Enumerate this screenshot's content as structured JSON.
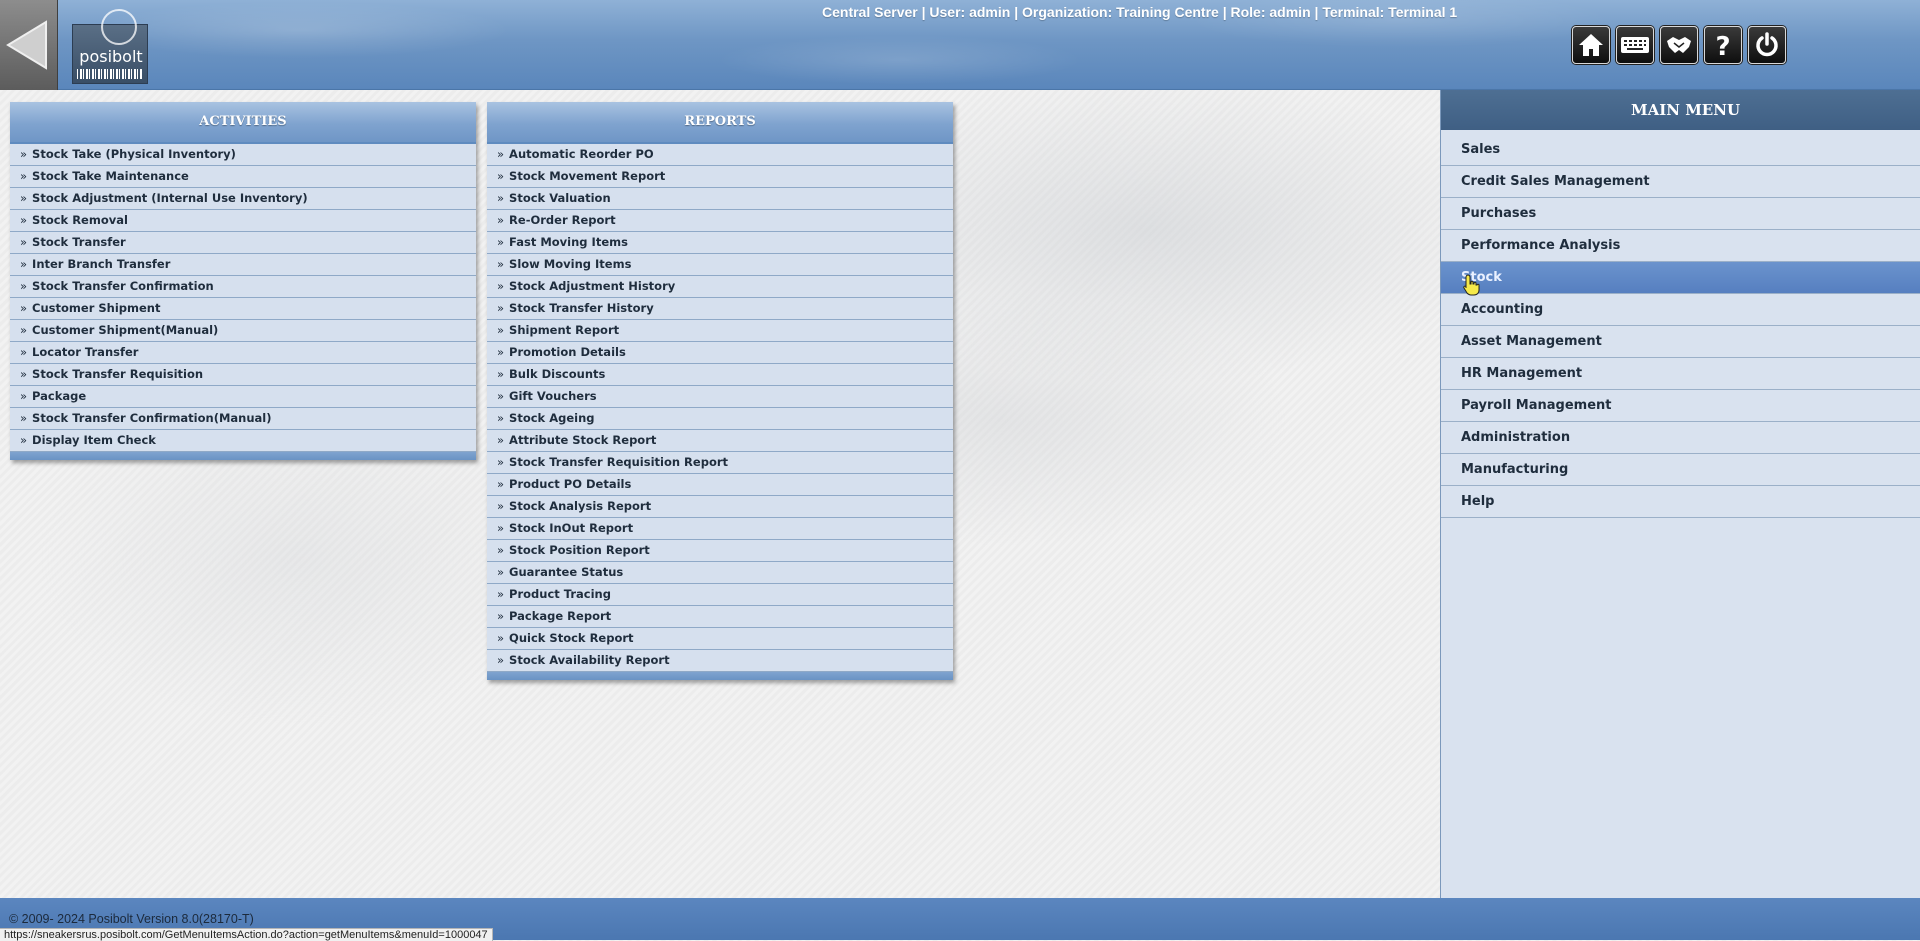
{
  "header": {
    "logo_text": "posibolt",
    "session_info": "Central Server | User: admin | Organization: Training Centre | Role: admin | Terminal: Terminal 1",
    "toolbar": [
      {
        "name": "home-button",
        "icon": "home-icon"
      },
      {
        "name": "keyboard-button",
        "icon": "keyboard-icon"
      },
      {
        "name": "support-button",
        "icon": "handshake-icon"
      },
      {
        "name": "help-button",
        "icon": "question-icon"
      },
      {
        "name": "logout-button",
        "icon": "power-icon"
      }
    ]
  },
  "activities": {
    "title": "ACTIVITIES",
    "items": [
      "Stock Take (Physical Inventory)",
      "Stock Take Maintenance",
      "Stock Adjustment (Internal Use Inventory)",
      "Stock Removal",
      "Stock Transfer",
      "Inter Branch Transfer",
      "Stock Transfer Confirmation",
      "Customer Shipment",
      "Customer Shipment(Manual)",
      "Locator Transfer",
      "Stock Transfer Requisition",
      "Package",
      "Stock Transfer Confirmation(Manual)",
      "Display Item Check"
    ]
  },
  "reports": {
    "title": "REPORTS",
    "items": [
      "Automatic Reorder PO",
      "Stock Movement Report",
      "Stock Valuation",
      "Re-Order Report",
      "Fast Moving Items",
      "Slow Moving Items",
      "Stock Adjustment History",
      "Stock Transfer History",
      "Shipment Report",
      "Promotion Details",
      "Bulk Discounts",
      "Gift Vouchers",
      "Stock Ageing",
      "Attribute Stock Report",
      "Stock Transfer Requisition Report",
      "Product PO Details",
      "Stock Analysis Report",
      "Stock InOut Report",
      "Stock Position Report",
      "Guarantee Status",
      "Product Tracing",
      "Package Report",
      "Quick Stock Report",
      "Stock Availability Report"
    ]
  },
  "main_menu": {
    "title": "MAIN MENU",
    "active": "Stock",
    "items": [
      "Sales",
      "Credit Sales Management",
      "Purchases",
      "Performance Analysis",
      "Stock",
      "Accounting",
      "Asset Management",
      "HR Management",
      "Payroll Management",
      "Administration",
      "Manufacturing",
      "Help"
    ]
  },
  "footer": {
    "copyright": "© 2009- 2024 Posibolt Version  8.0(28170-T)",
    "status_url": "https://sneakersrus.posibolt.com/GetMenuItemsAction.do?action=getMenuItems&menuId=1000047"
  },
  "colors": {
    "header_blue": "#6e96c4",
    "panel_bg": "#d6e0ee",
    "menu_active": "#6b93cd",
    "menu_header": "#4e6f93"
  }
}
